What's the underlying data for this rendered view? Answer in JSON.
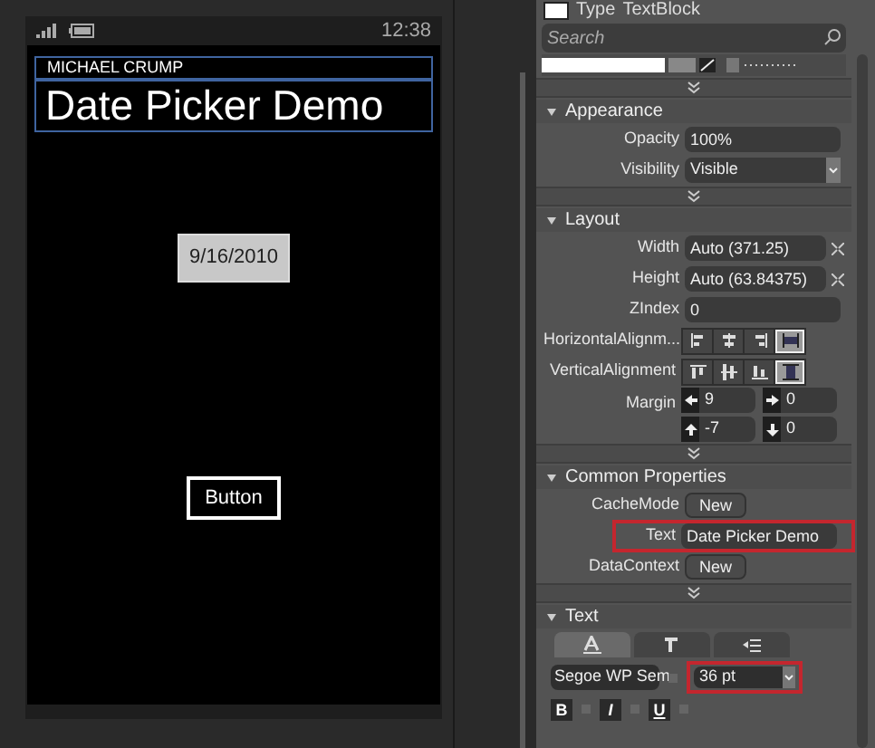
{
  "designer": {
    "status_bar": {
      "time": "12:38"
    },
    "app_title": "MICHAEL CRUMP",
    "page_title": "Date Picker Demo",
    "date_picker": {
      "value": "9/16/2010"
    },
    "button": {
      "label": "Button"
    }
  },
  "properties": {
    "type_label": "Type",
    "type_value": "TextBlock",
    "search": {
      "placeholder": "Search"
    },
    "sections": [
      {
        "title": "Appearance",
        "expanded": true,
        "rows": [
          {
            "kind": "text",
            "label": "Opacity",
            "value": "100%"
          },
          {
            "kind": "dropdown",
            "label": "Visibility",
            "value": "Visible"
          }
        ]
      },
      {
        "title": "Layout",
        "expanded": true,
        "rows": [
          {
            "kind": "text",
            "label": "Width",
            "value": "Auto (371.25)",
            "reset": true
          },
          {
            "kind": "text",
            "label": "Height",
            "value": "Auto (63.84375)",
            "reset": true
          },
          {
            "kind": "text",
            "label": "ZIndex",
            "value": "0"
          },
          {
            "kind": "halign",
            "label": "HorizontalAlignm...",
            "options": [
              {
                "selected": false
              },
              {
                "selected": false
              },
              {
                "selected": false
              },
              {
                "selected": true
              }
            ]
          },
          {
            "kind": "valign",
            "label": "VerticalAlignment",
            "options": [
              {
                "selected": false
              },
              {
                "selected": false
              },
              {
                "selected": false
              },
              {
                "selected": true
              }
            ]
          },
          {
            "kind": "margin",
            "label": "Margin",
            "values": [
              "9",
              "0",
              "-7",
              "0"
            ]
          }
        ]
      },
      {
        "title": "Common Properties",
        "expanded": true,
        "rows": [
          {
            "kind": "button",
            "label": "CacheMode",
            "value": "New"
          },
          {
            "kind": "text",
            "label": "Text",
            "value": "Date Picker Demo",
            "highlighted": true
          },
          {
            "kind": "button",
            "label": "DataContext",
            "value": "New"
          }
        ]
      },
      {
        "title": "Text",
        "expanded": true,
        "rows": [
          {
            "kind": "tabs",
            "tabs": [
              {
                "selected": true
              },
              {
                "selected": false
              },
              {
                "selected": false
              }
            ]
          },
          {
            "kind": "font",
            "family": "Segoe WP Sem",
            "size": "36 pt",
            "size_highlighted": true
          },
          {
            "kind": "styles",
            "buttons": [
              {
                "label": "B"
              },
              {
                "label": "I"
              },
              {
                "label": "U"
              }
            ]
          }
        ]
      }
    ]
  }
}
